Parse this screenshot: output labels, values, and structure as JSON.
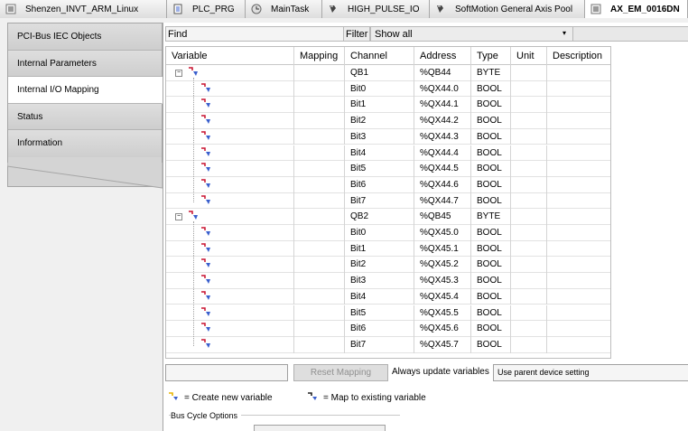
{
  "tabs": [
    {
      "label": "Shenzen_INVT_ARM_Linux",
      "icon": "device-icon",
      "active": false
    },
    {
      "label": "PLC_PRG",
      "icon": "program-icon",
      "active": false
    },
    {
      "label": "MainTask",
      "icon": "task-icon",
      "active": false
    },
    {
      "label": "HIGH_PULSE_IO",
      "icon": "pou-icon",
      "active": false
    },
    {
      "label": "SoftMotion General Axis Pool",
      "icon": "pou-icon",
      "active": false
    },
    {
      "label": "AX_EM_0016DN",
      "icon": "device-icon",
      "active": true
    }
  ],
  "sidebar": {
    "items": [
      {
        "label": "PCI-Bus IEC Objects",
        "active": false
      },
      {
        "label": "Internal Parameters",
        "active": false
      },
      {
        "label": "Internal I/O Mapping",
        "active": true
      },
      {
        "label": "Status",
        "active": false
      },
      {
        "label": "Information",
        "active": false
      }
    ]
  },
  "toolbar": {
    "find_label": "Find",
    "filter_label": "Filter",
    "filter_value": "Show all"
  },
  "table": {
    "columns": [
      "Variable",
      "Mapping",
      "Channel",
      "Address",
      "Type",
      "Unit",
      "Description"
    ],
    "rows": [
      {
        "kind": "parent",
        "channel": "QB1",
        "address": "%QB44",
        "type": "BYTE"
      },
      {
        "kind": "child",
        "channel": "Bit0",
        "address": "%QX44.0",
        "type": "BOOL"
      },
      {
        "kind": "child",
        "channel": "Bit1",
        "address": "%QX44.1",
        "type": "BOOL"
      },
      {
        "kind": "child",
        "channel": "Bit2",
        "address": "%QX44.2",
        "type": "BOOL"
      },
      {
        "kind": "child",
        "channel": "Bit3",
        "address": "%QX44.3",
        "type": "BOOL"
      },
      {
        "kind": "child",
        "channel": "Bit4",
        "address": "%QX44.4",
        "type": "BOOL"
      },
      {
        "kind": "child",
        "channel": "Bit5",
        "address": "%QX44.5",
        "type": "BOOL"
      },
      {
        "kind": "child",
        "channel": "Bit6",
        "address": "%QX44.6",
        "type": "BOOL"
      },
      {
        "kind": "child",
        "channel": "Bit7",
        "address": "%QX44.7",
        "type": "BOOL"
      },
      {
        "kind": "parent",
        "channel": "QB2",
        "address": "%QB45",
        "type": "BYTE"
      },
      {
        "kind": "child",
        "channel": "Bit0",
        "address": "%QX45.0",
        "type": "BOOL"
      },
      {
        "kind": "child",
        "channel": "Bit1",
        "address": "%QX45.1",
        "type": "BOOL"
      },
      {
        "kind": "child",
        "channel": "Bit2",
        "address": "%QX45.2",
        "type": "BOOL"
      },
      {
        "kind": "child",
        "channel": "Bit3",
        "address": "%QX45.3",
        "type": "BOOL"
      },
      {
        "kind": "child",
        "channel": "Bit4",
        "address": "%QX45.4",
        "type": "BOOL"
      },
      {
        "kind": "child",
        "channel": "Bit5",
        "address": "%QX45.5",
        "type": "BOOL"
      },
      {
        "kind": "child",
        "channel": "Bit6",
        "address": "%QX45.6",
        "type": "BOOL"
      },
      {
        "kind": "child",
        "channel": "Bit7",
        "address": "%QX45.7",
        "type": "BOOL"
      }
    ]
  },
  "bottom": {
    "reset_label": "Reset Mapping",
    "always_update_label": "Always update variables",
    "parent_setting_value": "Use parent device setting"
  },
  "legend": {
    "create_label": "= Create new variable",
    "map_label": "= Map to existing variable"
  },
  "bus_cycle": {
    "label": "Bus Cycle Options"
  },
  "colors": {
    "icon_blue": "#3a5fcd",
    "icon_red": "#c8102e",
    "icon_yellow": "#e8b400"
  }
}
